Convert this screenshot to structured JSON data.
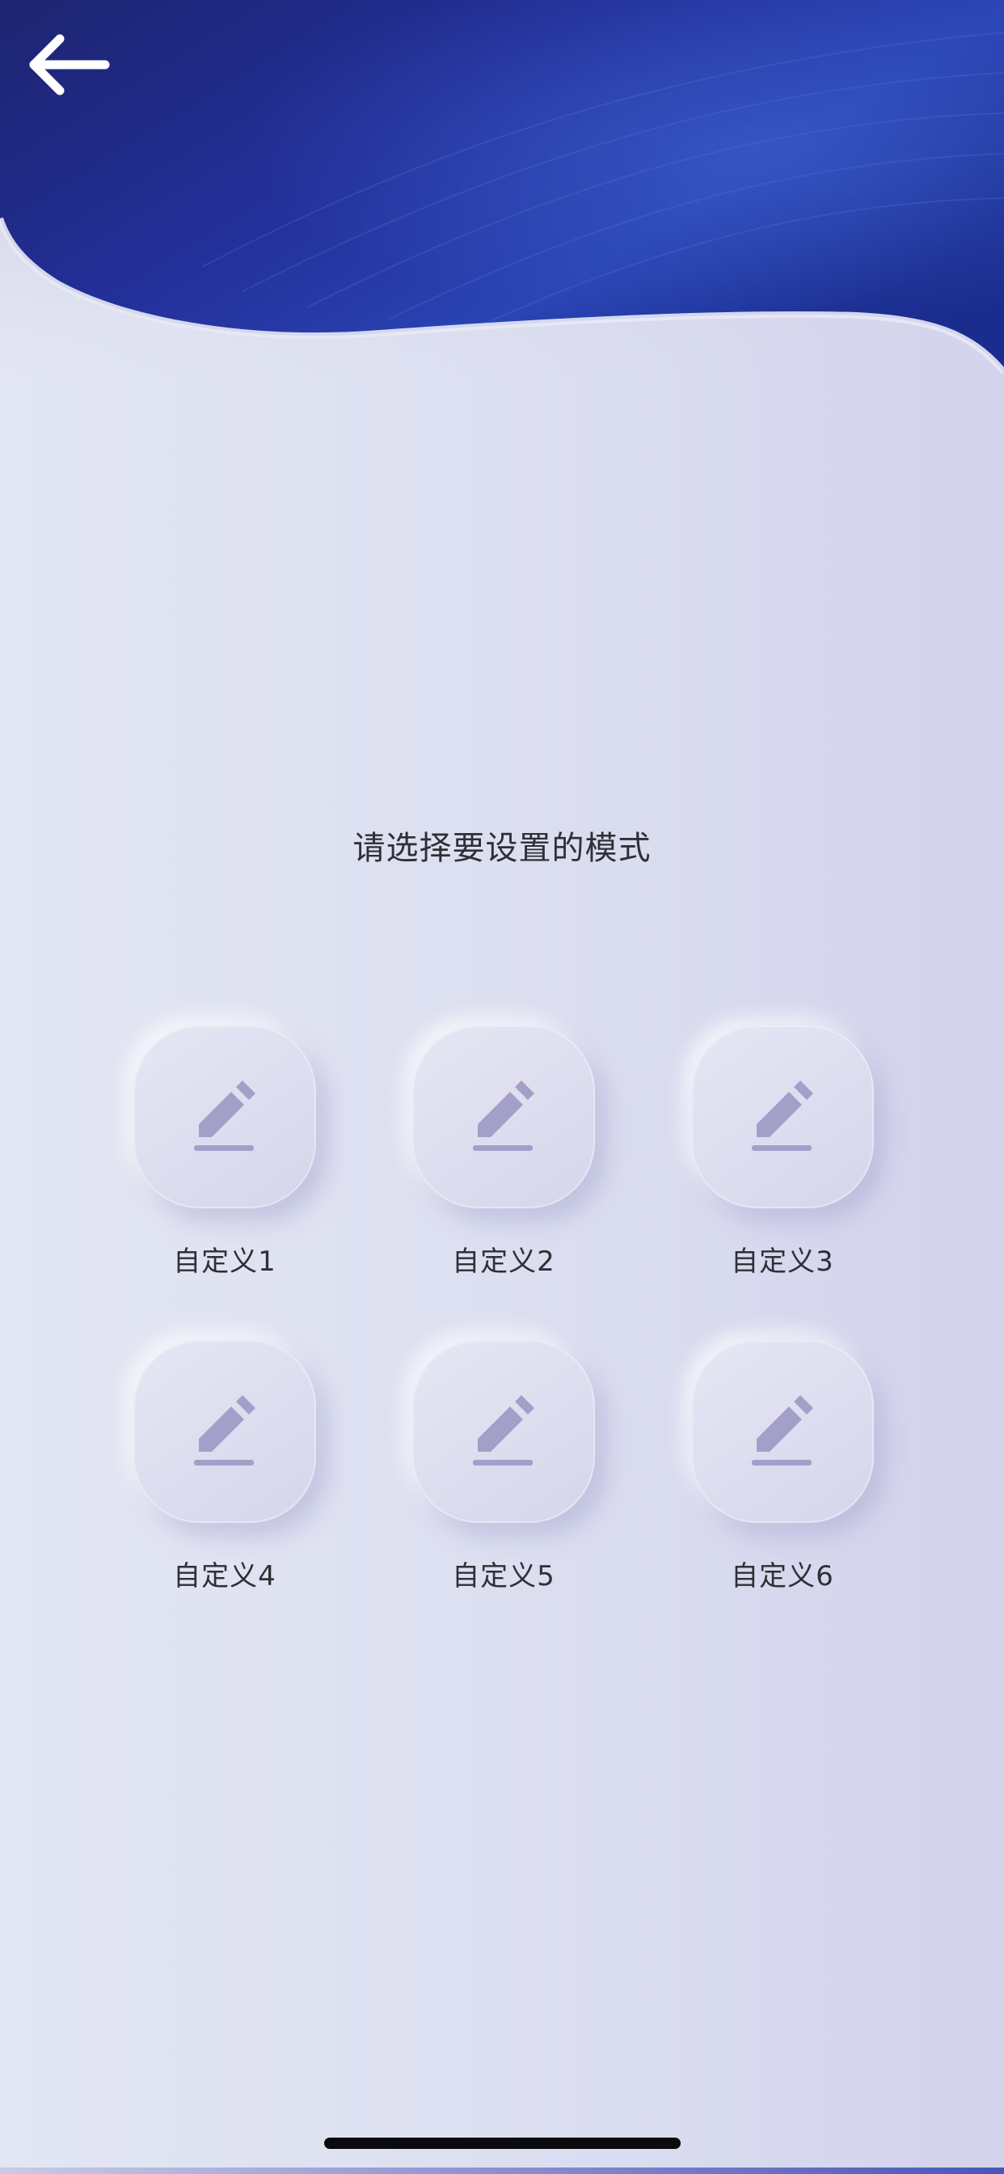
{
  "header": {
    "back_icon": "arrow-left-icon"
  },
  "title": "请选择要设置的模式",
  "modes": [
    {
      "label": "自定义1",
      "icon": "pencil-edit-icon"
    },
    {
      "label": "自定义2",
      "icon": "pencil-edit-icon"
    },
    {
      "label": "自定义3",
      "icon": "pencil-edit-icon"
    },
    {
      "label": "自定义4",
      "icon": "pencil-edit-icon"
    },
    {
      "label": "自定义5",
      "icon": "pencil-edit-icon"
    },
    {
      "label": "自定义6",
      "icon": "pencil-edit-icon"
    }
  ],
  "colors": {
    "header_blue": "#1b2a86",
    "icon_purple": "#a49fc9",
    "text": "#2f2f36"
  }
}
